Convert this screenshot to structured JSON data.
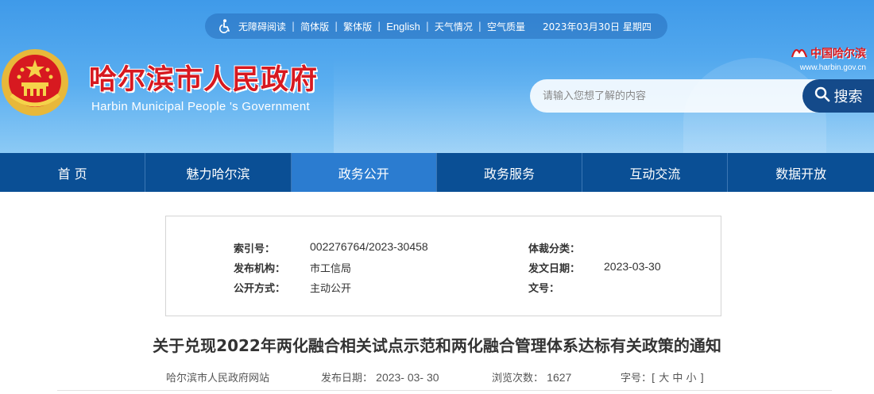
{
  "topbar": {
    "accessibility": "无障碍阅读",
    "simplified": "简体版",
    "traditional": "繁体版",
    "english": "English",
    "weather": "天气情况",
    "air_quality": "空气质量",
    "date": "2023年03月30日 星期四",
    "separator": "|"
  },
  "header": {
    "title": "哈尔滨市人民政府",
    "subtitle": "Harbin Municipal People 's Government",
    "brand_name": "中国哈尔滨",
    "brand_url": "www.harbin.gov.cn"
  },
  "search": {
    "placeholder": "请输入您想了解的内容",
    "button_label": "搜索"
  },
  "nav": {
    "items": [
      {
        "label": "首 页"
      },
      {
        "label": "魅力哈尔滨"
      },
      {
        "label": "政务公开"
      },
      {
        "label": "政务服务"
      },
      {
        "label": "互动交流"
      },
      {
        "label": "数据开放"
      }
    ],
    "active_index": 2
  },
  "info": {
    "index_label": "索引号：",
    "index_value": "002276764/2023-30458",
    "genre_label": "体裁分类：",
    "genre_value": "",
    "publisher_label": "发布机构：",
    "publisher_value": "市工信局",
    "issue_date_label": "发文日期：",
    "issue_date_value": "2023-03-30",
    "disclosure_label": "公开方式：",
    "disclosure_value": "主动公开",
    "doc_no_label": "文号：",
    "doc_no_value": ""
  },
  "article": {
    "title": "关于兑现2022年两化融合相关试点示范和两化融合管理体系达标有关政策的通知",
    "source": "哈尔滨市人民政府网站",
    "publish_label": "发布日期：",
    "publish_date": "2023- 03- 30",
    "views_label": "浏览次数：",
    "views": "1627",
    "font_label": "字号：[",
    "font_large": "大",
    "font_medium": "中",
    "font_small": "小",
    "font_close": "]"
  },
  "colors": {
    "nav_bg": "#0a4f95",
    "nav_active": "#2b7cd0",
    "title_red": "#d71920",
    "search_button": "#144a8a"
  }
}
